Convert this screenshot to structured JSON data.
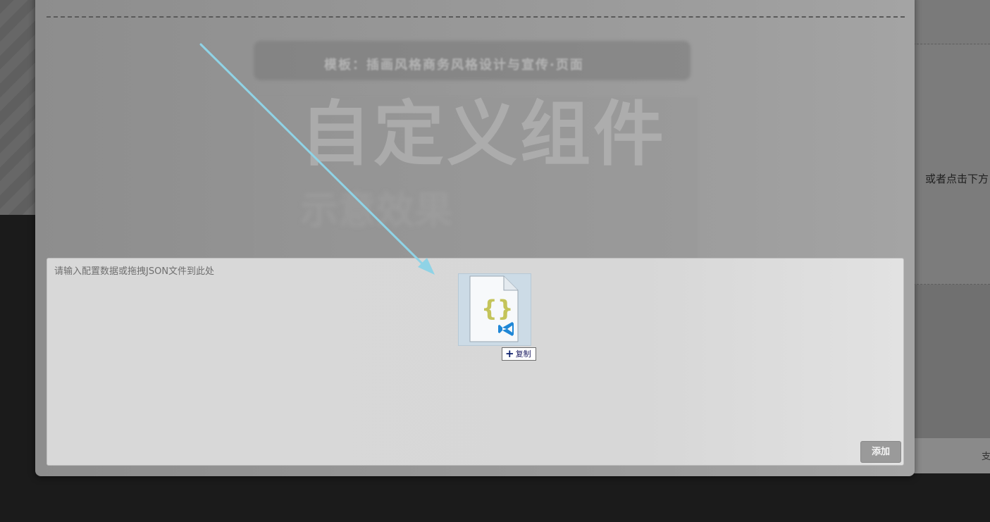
{
  "background": {
    "right_text": "或者点击下方",
    "right_text_2": "支"
  },
  "modal": {
    "preview": {
      "banner_text": "模板：插画风格商务风格设计与宣传·页面",
      "title": "自定义组件",
      "subtitle": "示意效果"
    },
    "config_input": {
      "placeholder": "请输入配置数据或拖拽JSON文件到此处",
      "value": ""
    },
    "add_button_label": "添加"
  },
  "drag": {
    "file_icon": "json-file-icon",
    "tooltip_icon": "plus-icon",
    "tooltip_label": "复制"
  },
  "colors": {
    "overlay_modal": "#969696",
    "arrow": "#8fd3e6",
    "json_braces": "#c4c45a",
    "vscode_blue": "#1f87d6"
  }
}
